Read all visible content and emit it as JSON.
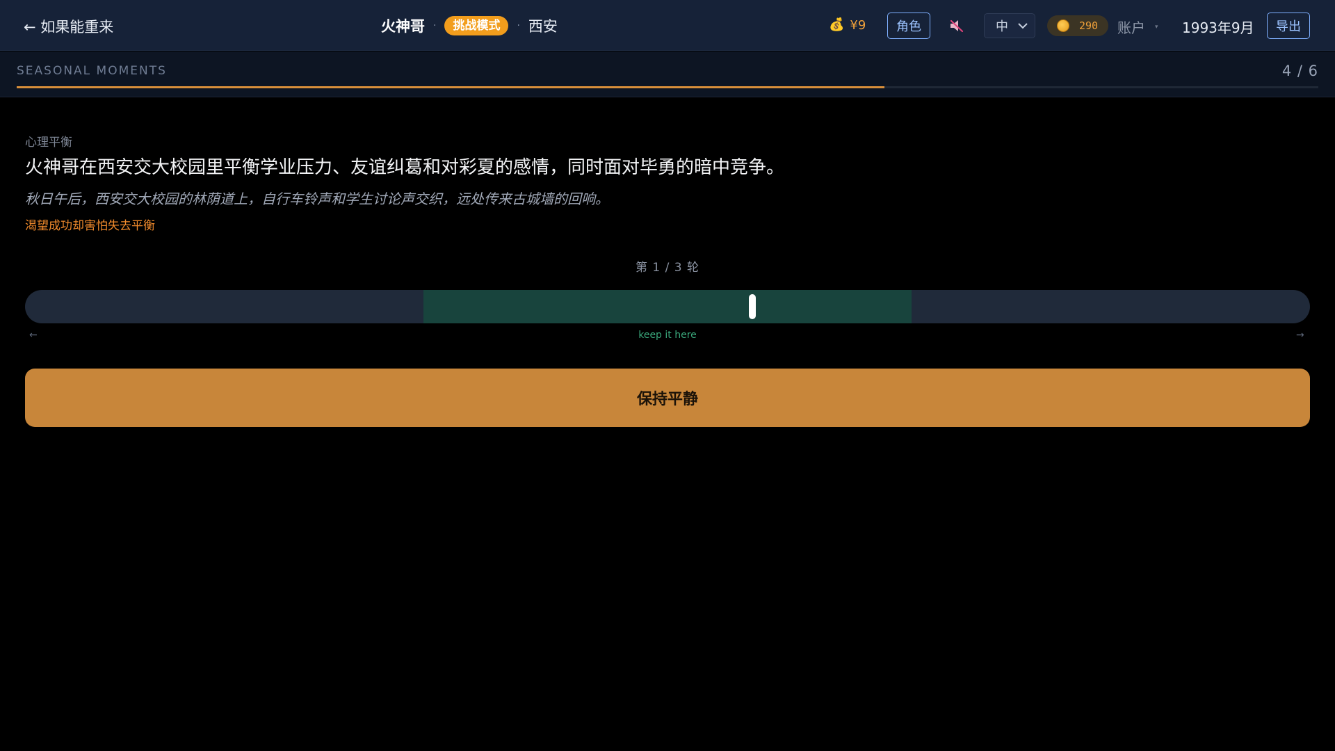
{
  "header": {
    "back_label": "← 如果能重来",
    "character_name": "火神哥",
    "separator": "·",
    "mode_badge": "挑战模式",
    "city": "西安",
    "money_icon": "money-bag-icon",
    "money": "¥9",
    "role_button": "角色",
    "mute_icon": "speaker-muted-icon",
    "language": {
      "selected": "中",
      "options": [
        "中"
      ]
    },
    "coin_icon": "gold-coin-icon",
    "coins": "290",
    "account_label": "账户",
    "account_caret": "▾",
    "date": "1993年9月",
    "export_button": "导出"
  },
  "progress": {
    "section_label": "SEASONAL MOMENTS",
    "step_text": "4 / 6",
    "current": 4,
    "total": 6,
    "fill_color": "#d88f3a"
  },
  "moment": {
    "category": "心理平衡",
    "headline": "火神哥在西安交大校园里平衡学业压力、友谊纠葛和对彩夏的感情，同时面对毕勇的暗中竞争。",
    "scene": "秋日午后，西安交大校园的林荫道上，自行车铃声和学生讨论声交织，远处传来古城墙的回响。",
    "conflict": "渴望成功却害怕失去平衡"
  },
  "game": {
    "round_text": "第 1 / 3 轮",
    "safe_zone_start": 0.31,
    "safe_zone_end": 0.69,
    "marker_position": 0.566,
    "left_arrow": "←",
    "right_arrow": "→",
    "hint": "keep it here",
    "action_button": "保持平静",
    "colors": {
      "track": "#202a3a",
      "safe_zone": "#18443d",
      "marker": "#ffffff",
      "action": "#c8863a"
    }
  }
}
